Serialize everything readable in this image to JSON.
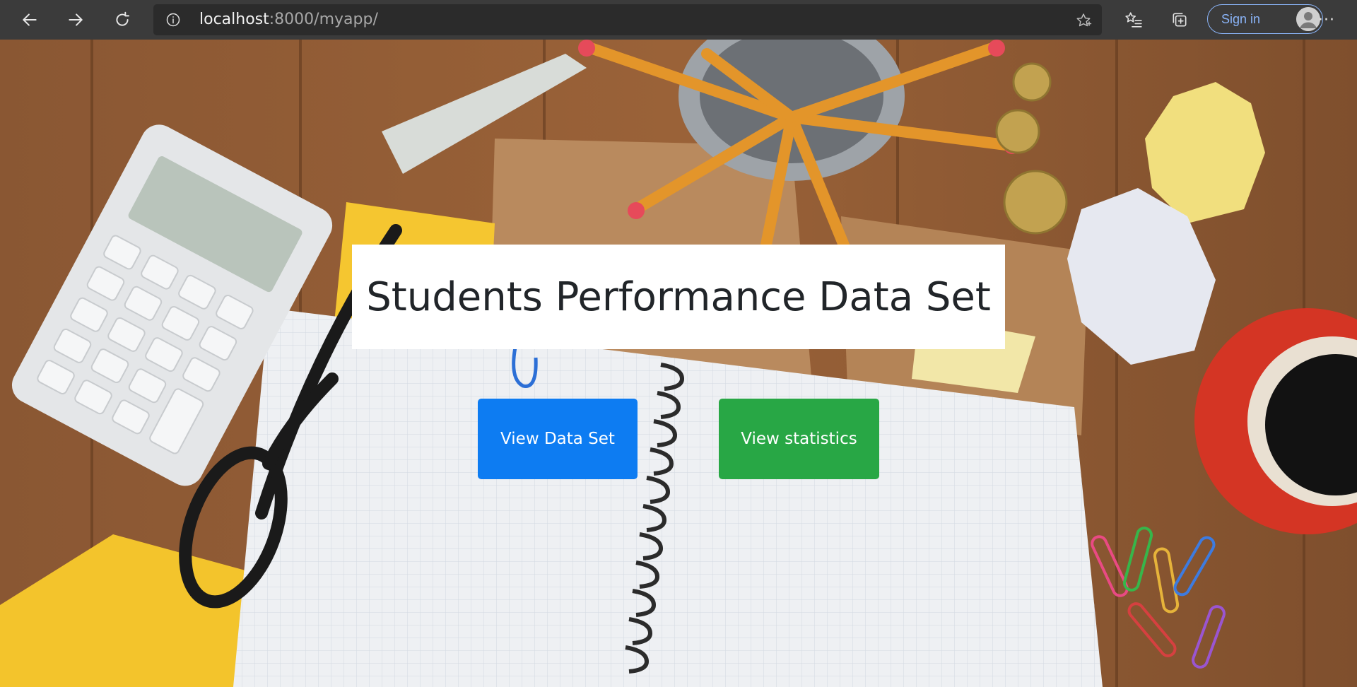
{
  "browser": {
    "url_host": "localhost",
    "url_path": ":8000/myapp/",
    "sign_in_label": "Sign in",
    "more_label": "···",
    "icons": {
      "back": "arrow-left-icon",
      "forward": "arrow-right-icon",
      "reload": "reload-icon",
      "info": "info-icon",
      "favorite": "star-icon",
      "favorites": "favorites-list-icon",
      "collections": "collections-icon",
      "profile": "avatar-icon"
    },
    "colors": {
      "toolbar_bg": "#3b3b3b",
      "address_bg": "#2b2b2b",
      "signin_accent": "#8ab4f8"
    }
  },
  "page": {
    "title": "Students Performance Data Set",
    "buttons": {
      "view_data_set": "View Data Set",
      "view_statistics": "View statistics"
    },
    "colors": {
      "primary_button": "#0d7cf2",
      "success_button": "#28a745",
      "title_text": "#212529"
    }
  }
}
